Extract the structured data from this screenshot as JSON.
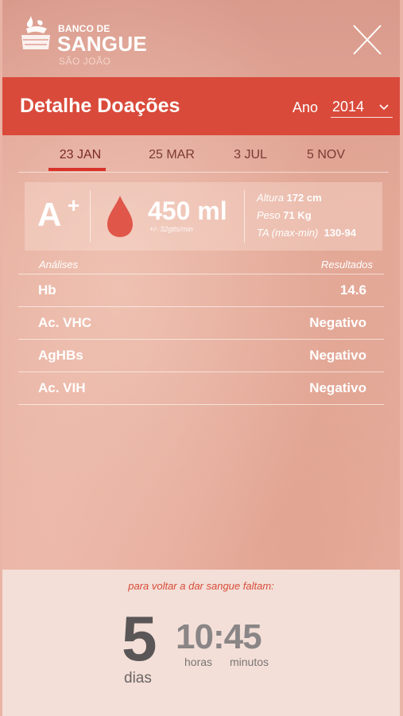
{
  "brand": {
    "line1": "BANCO DE",
    "line2": "SANGUE",
    "line3": "SÃO JOÃO"
  },
  "icons": {
    "close": "close-icon",
    "logo": "blood-bank-logo",
    "dropdown": "chevron-down-icon",
    "drop": "blood-drop-icon"
  },
  "header": {
    "title": "Detalhe Doações",
    "year_label": "Ano",
    "year_value": "2014"
  },
  "tabs": [
    {
      "label": "23 JAN",
      "active": true
    },
    {
      "label": "25 MAR",
      "active": false
    },
    {
      "label": "3 JUL",
      "active": false
    },
    {
      "label": "5 NOV",
      "active": false
    }
  ],
  "summary": {
    "blood_group": "A",
    "rh": "+",
    "volume": "450 ml",
    "drip_rate": "+/- 32gtts/min",
    "height_label": "Altura",
    "height_value": "172 cm",
    "weight_label": "Peso",
    "weight_value": "71 Kg",
    "bp_label": "TA (max-min)",
    "bp_value": "130-94"
  },
  "analyses": {
    "col_name": "Análises",
    "col_result": "Resultados",
    "rows": [
      {
        "name": "Hb",
        "result": "14.6"
      },
      {
        "name": "Ac. VHC",
        "result": "Negativo"
      },
      {
        "name": "AgHBs",
        "result": "Negativo"
      },
      {
        "name": "Ac. VIH",
        "result": "Negativo"
      }
    ]
  },
  "countdown": {
    "label": "para voltar a dar sangue faltam:",
    "days": "5",
    "days_unit": "dias",
    "time": "10:45",
    "hours_unit": "horas",
    "minutes_unit": "minutos"
  },
  "colors": {
    "accent": "#d94a3b",
    "tab_indicator": "#d8322a",
    "drop": "#e0574a",
    "countdown_label": "#d84c3a"
  }
}
